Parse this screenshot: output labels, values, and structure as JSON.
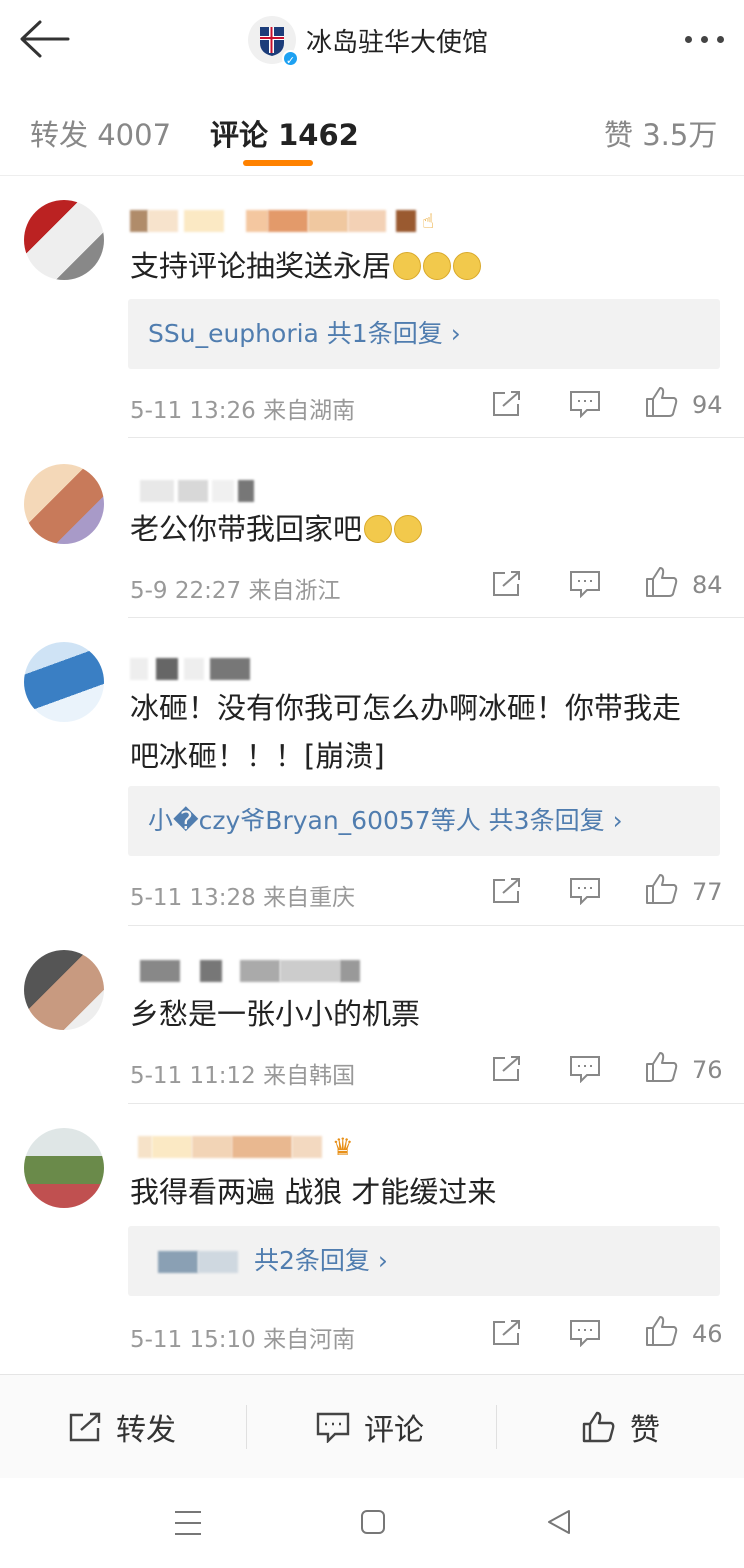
{
  "header": {
    "back_icon": "back-arrow-icon",
    "title": "冰岛驻华大使馆",
    "more_icon": "more-dots-icon"
  },
  "tabs": [
    {
      "label": "转发 4007"
    },
    {
      "label": "评论 1462"
    },
    {
      "label": "赞 3.5万"
    }
  ],
  "colors": {
    "accent": "#ff8200",
    "link": "#507daf",
    "muted": "#999999"
  },
  "comments": [
    {
      "text": "支持评论抽奖送永居",
      "emojis": 3,
      "reply": {
        "text": "SSu_euphoria  共1条回复"
      },
      "time": "5-11 13:26  来自湖南",
      "likes": "94"
    },
    {
      "text": "老公你带我回家吧",
      "emojis": 2,
      "time": "5-9 22:27  来自浙江",
      "likes": "84"
    },
    {
      "text_line1": "冰砸！没有你我可怎么办啊冰砸！你带我走",
      "text_line2": "吧冰砸！！！[崩溃]",
      "reply": {
        "text": "小�czy爷Bryan_60057等人  共3条回复"
      },
      "time": "5-11 13:28  来自重庆",
      "likes": "77"
    },
    {
      "text": "乡愁是一张小小的机票",
      "time": "5-11 11:12  来自韩国",
      "likes": "76"
    },
    {
      "text": "我得看两遍 战狼 才能缓过来",
      "reply": {
        "text": "共2条回复"
      },
      "time": "5-11 15:10  来自河南",
      "likes": "46"
    }
  ],
  "bottom": {
    "repost": "转发",
    "comment": "评论",
    "like": "赞"
  }
}
